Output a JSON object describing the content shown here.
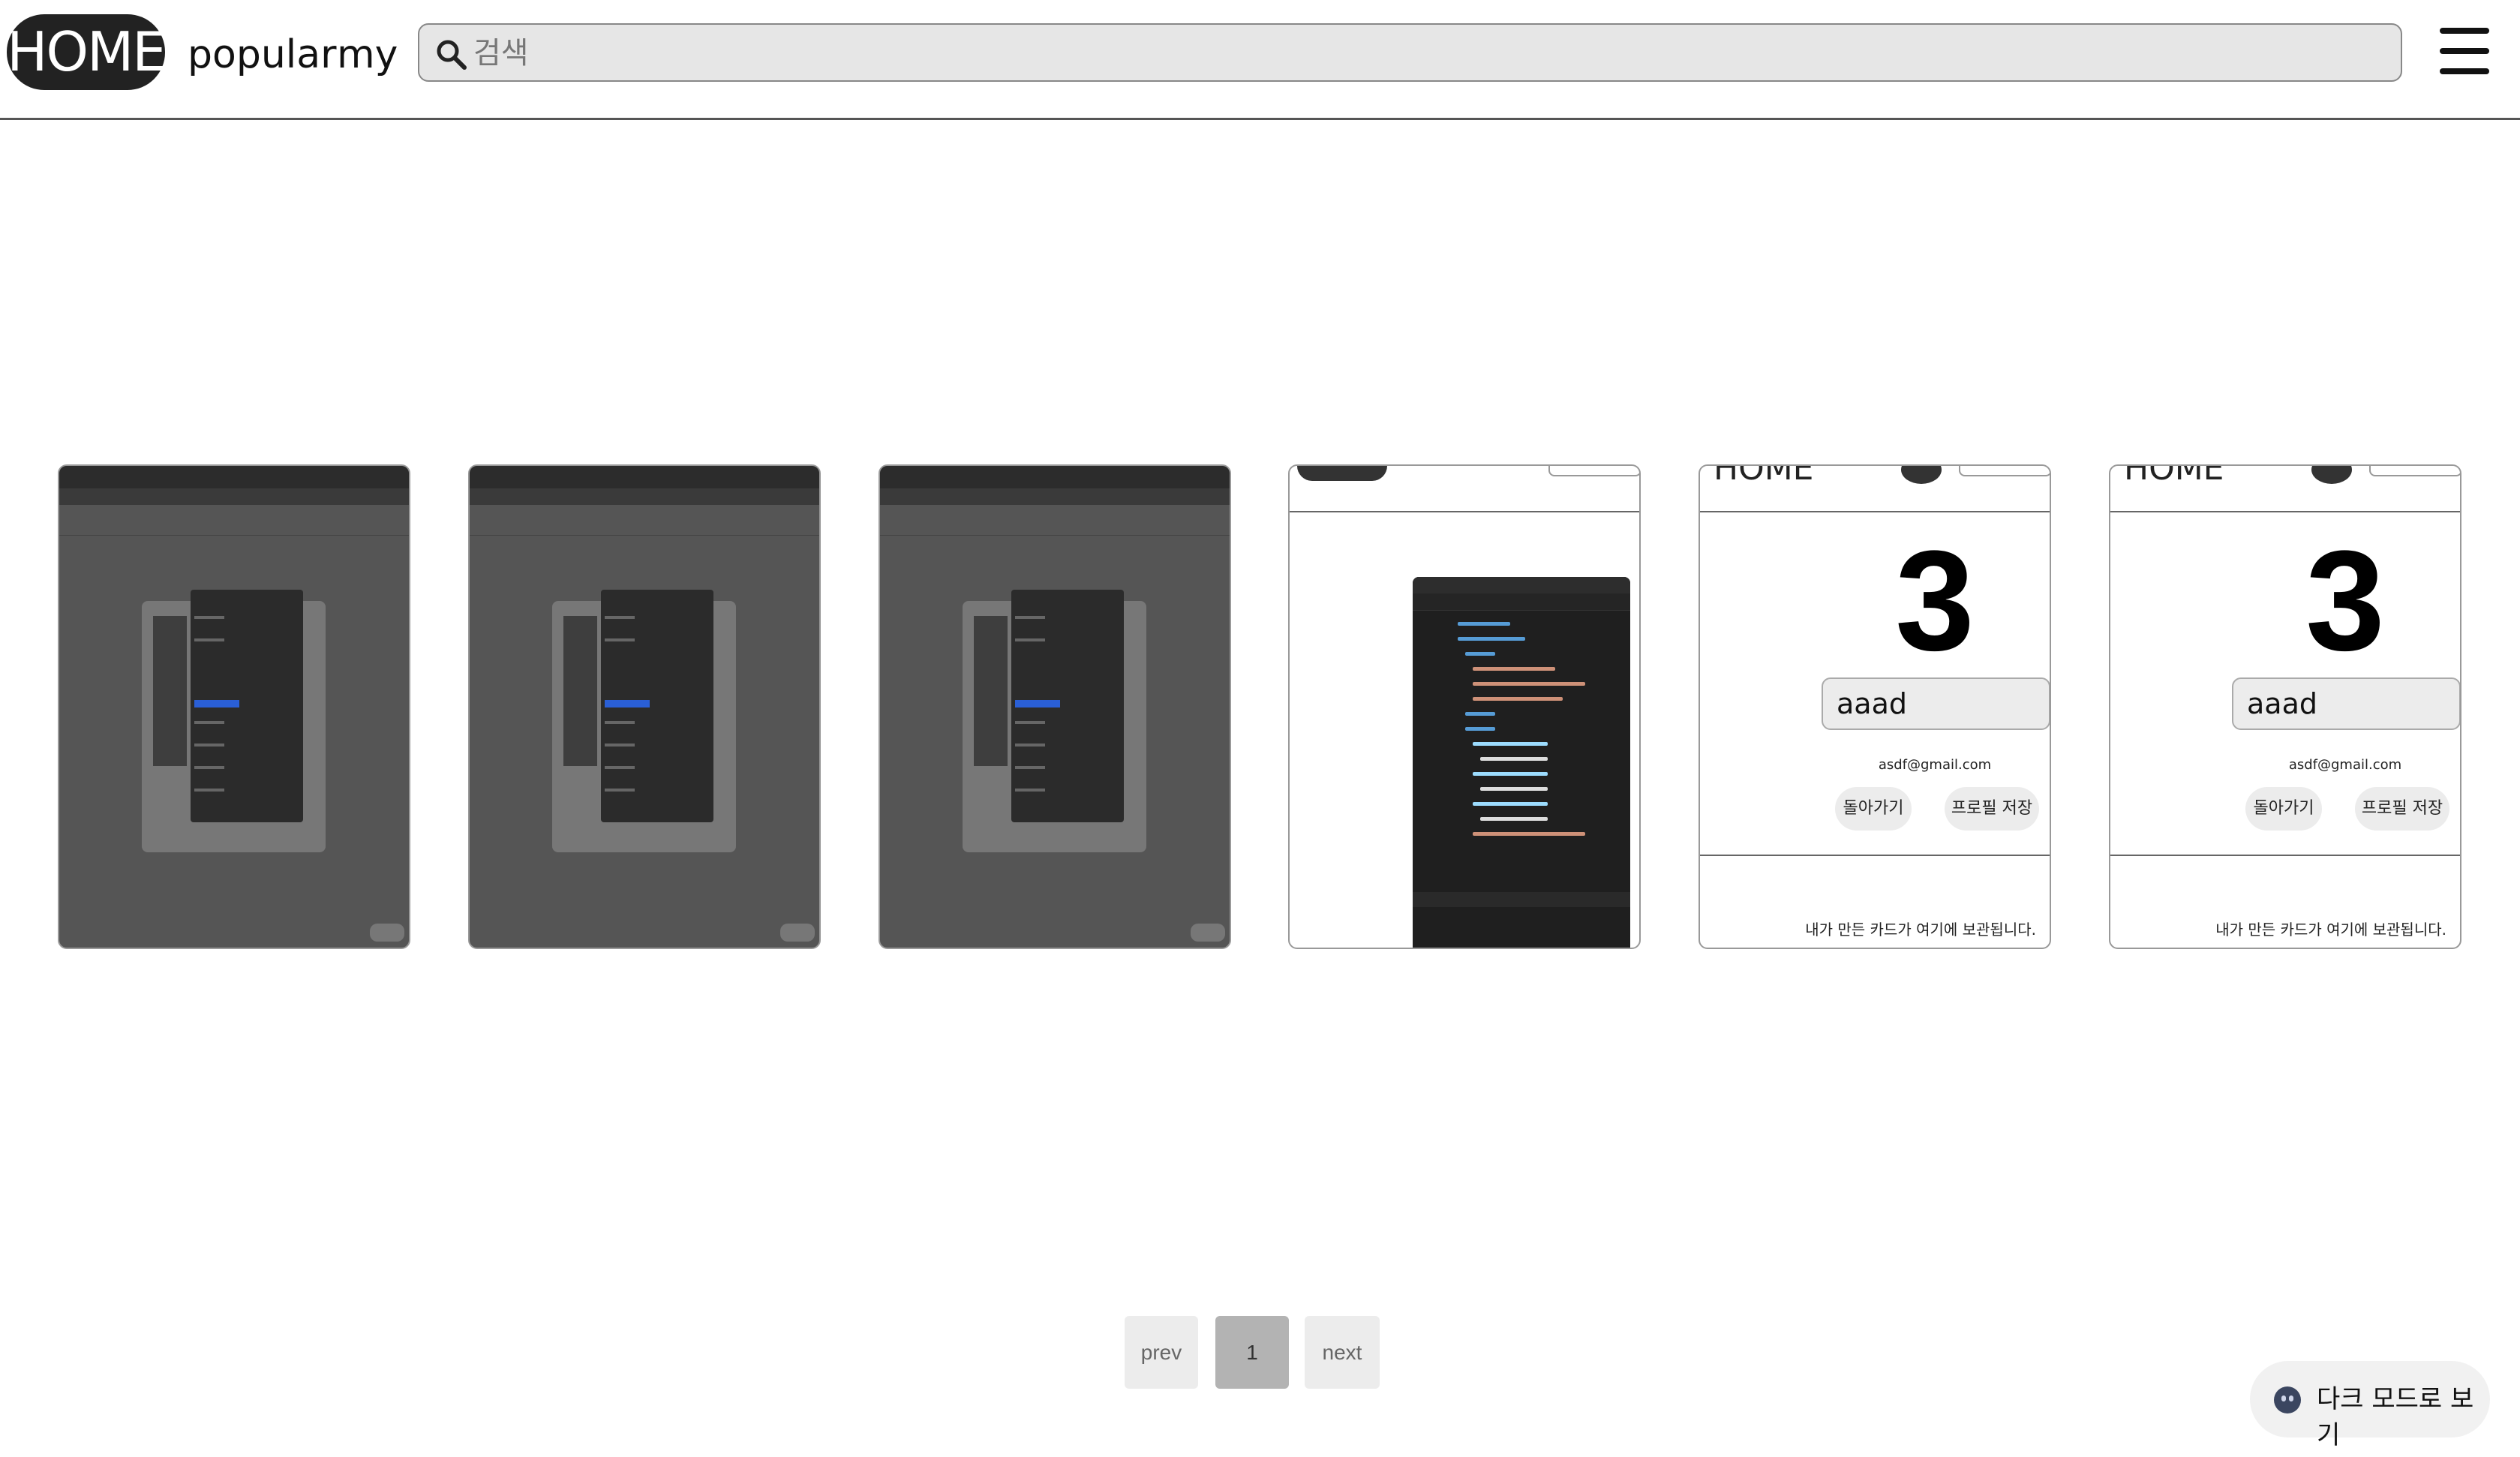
{
  "header": {
    "logo": "HOME",
    "nav": [
      "popular",
      "my"
    ],
    "search_placeholder": "검색"
  },
  "cards": [
    {
      "kind": "screenshot"
    },
    {
      "kind": "screenshot"
    },
    {
      "kind": "screenshot"
    },
    {
      "kind": "code"
    },
    {
      "kind": "profile",
      "home": "HOME",
      "number": "3",
      "name": "aaad",
      "email": "asdf@gmail.com",
      "back_label": "돌아가기",
      "save_label": "프로필 저장",
      "note": "내가 만든 카드가 여기에 보관됩니다."
    },
    {
      "kind": "profile",
      "home": "HOME",
      "number": "3",
      "name": "aaad",
      "email": "asdf@gmail.com",
      "back_label": "돌아가기",
      "save_label": "프로필 저장",
      "note": "내가 만든 카드가 여기에 보관됩니다."
    }
  ],
  "pagination": {
    "prev": "prev",
    "current": "1",
    "next": "next"
  },
  "dark_mode": {
    "label": "다크 모드로 보기",
    "icon": "moon-icon"
  },
  "colors": {
    "logo_bg": "#222222",
    "search_bg": "#e6e6e6",
    "card_screenshot_bg": "#555555",
    "page_current_bg": "#b3b3b3",
    "code_keyword": "#569cd6",
    "code_string": "#ce9178"
  }
}
